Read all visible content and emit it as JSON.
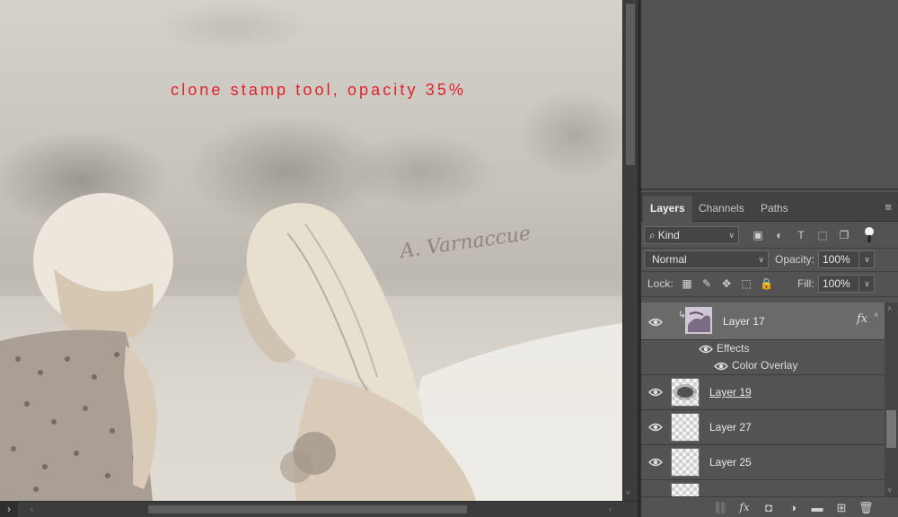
{
  "canvas": {
    "annotation": "clone stamp tool, opacity 35%",
    "script_text": "A. Varnaccue"
  },
  "scrollbars": {
    "expand_icon": "chevron-right-icon",
    "left_arrow": "‹",
    "right_arrow": "›",
    "up_arrow": "˄",
    "down_arrow": "˅"
  },
  "layers_panel": {
    "tabs": [
      {
        "label": "Layers",
        "active": true
      },
      {
        "label": "Channels",
        "active": false
      },
      {
        "label": "Paths",
        "active": false
      }
    ],
    "menu_icon": "≡",
    "filter": {
      "kind_label": "Kind",
      "search_glyph": "⌕",
      "icons": [
        "image-filter-icon",
        "adjustment-filter-icon",
        "type-filter-icon",
        "shape-filter-icon",
        "smart-object-filter-icon"
      ],
      "icon_glyphs": [
        "▣",
        "◐",
        "T",
        "⬚",
        "❐"
      ]
    },
    "blend_mode": "Normal",
    "opacity_label": "Opacity:",
    "opacity_value": "100%",
    "lock_label": "Lock:",
    "lock_icons": [
      "lock-transparent-pixels-icon",
      "lock-image-pixels-icon",
      "lock-position-icon",
      "lock-artboard-icon",
      "lock-all-icon"
    ],
    "lock_glyphs": [
      "▦",
      "✎",
      "✥",
      "⬚",
      "🔒"
    ],
    "fill_label": "Fill:",
    "fill_value": "100%",
    "layers": [
      {
        "name": "Layer 17",
        "selected": true,
        "clipped": true,
        "has_fx": true,
        "fx_label": "fx"
      },
      {
        "name": "Layer 19",
        "selected": false
      },
      {
        "name": "Layer 27",
        "selected": false
      },
      {
        "name": "Layer 25",
        "selected": false
      }
    ],
    "effects_label": "Effects",
    "effect_items": [
      "Color Overlay"
    ],
    "footer_icons": [
      "link-layers-icon",
      "layer-style-icon",
      "add-mask-icon",
      "new-adjustment-layer-icon",
      "new-group-icon",
      "new-layer-icon",
      "delete-layer-icon"
    ],
    "footer_glyphs": [
      "⛓",
      "fx",
      "◘",
      "◑",
      "▬",
      "⊞",
      "🗑"
    ]
  }
}
